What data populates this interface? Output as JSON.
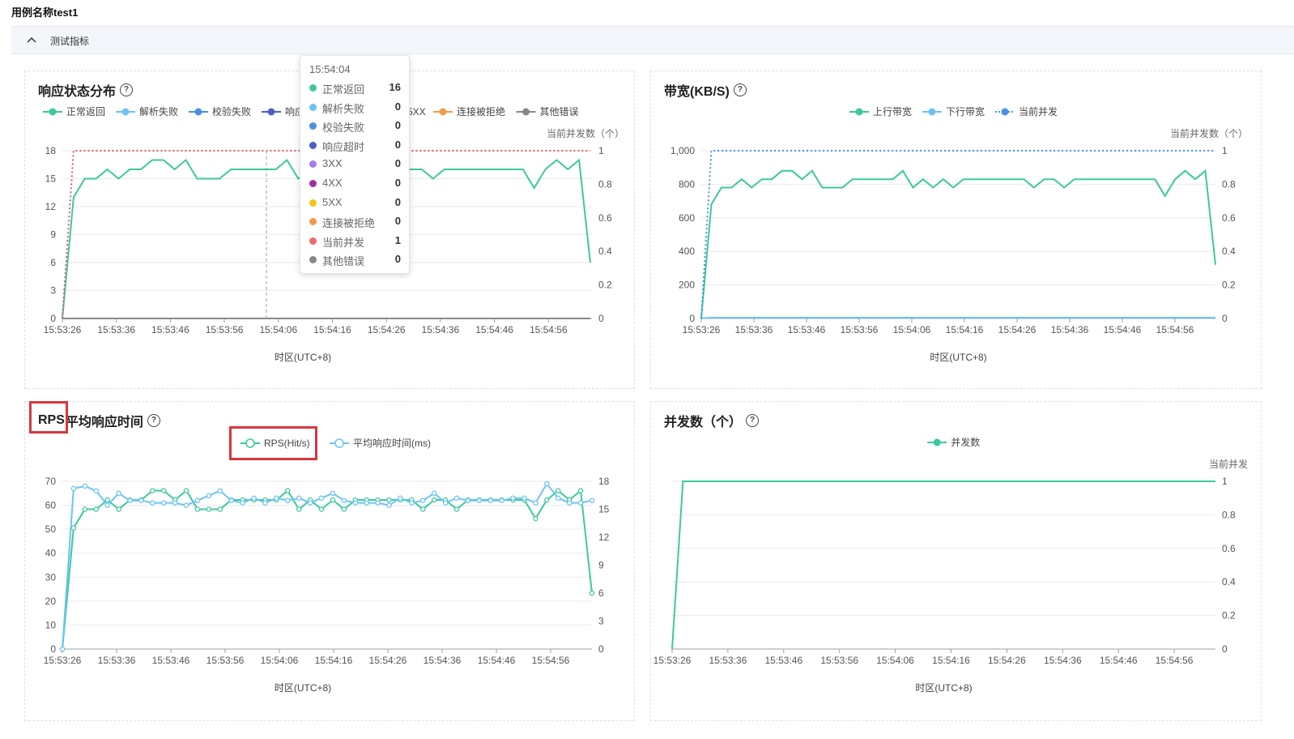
{
  "header": {
    "case_title": "用例名称test1",
    "section_label": "测试指标"
  },
  "panels": {
    "status": {
      "title": "响应状态分布"
    },
    "bandwidth": {
      "title": "带宽(KB/S)"
    },
    "rps": {
      "title_part1": "RPS",
      "title_part2": "平均响应时间"
    },
    "concurrency": {
      "title": "并发数（个）"
    }
  },
  "tooltip": {
    "time": "15:54:04",
    "rows": [
      {
        "name": "正常返回",
        "value": "16",
        "color": "#3cc99b"
      },
      {
        "name": "解析失败",
        "value": "0",
        "color": "#6ec3f4"
      },
      {
        "name": "校验失败",
        "value": "0",
        "color": "#4a90e2"
      },
      {
        "name": "响应超时",
        "value": "0",
        "color": "#4c5fc7"
      },
      {
        "name": "3XX",
        "value": "0",
        "color": "#a97be8"
      },
      {
        "name": "4XX",
        "value": "0",
        "color": "#9b2fa3"
      },
      {
        "name": "5XX",
        "value": "0",
        "color": "#f5c518"
      },
      {
        "name": "连接被拒绝",
        "value": "0",
        "color": "#f39a4a"
      },
      {
        "name": "当前并发",
        "value": "1",
        "color": "#ef6b6b"
      },
      {
        "name": "其他错误",
        "value": "0",
        "color": "#888888"
      }
    ]
  },
  "colors": {
    "green": "#3cc99b",
    "lightblue": "#6ec3f4",
    "blue": "#4a90e2",
    "red": "#e05a5a",
    "highlight": "#d9363e"
  },
  "chart_data": [
    {
      "type": "line",
      "id": "status",
      "legend": [
        {
          "name": "正常返回",
          "color": "#3cc99b"
        },
        {
          "name": "解析失败",
          "color": "#6ec3f4"
        },
        {
          "name": "校验失败",
          "color": "#4a90e2"
        },
        {
          "name": "响应超时",
          "color": "#4c5fc7"
        },
        {
          "name": "4XX",
          "color": "#9b2fa3"
        },
        {
          "name": "5XX",
          "color": "#f5c518"
        },
        {
          "name": "连接被拒绝",
          "color": "#f39a4a"
        },
        {
          "name": "其他错误",
          "color": "#888888"
        }
      ],
      "x_ticks": [
        "15:53:26",
        "15:53:36",
        "15:53:46",
        "15:53:56",
        "15:54:06",
        "15:54:16",
        "15:54:26",
        "15:54:36",
        "15:54:46",
        "15:54:56"
      ],
      "xlabel": "时区(UTC+8)",
      "y_left_ticks": [
        0,
        3,
        6,
        9,
        12,
        15,
        18
      ],
      "y_right_ticks": [
        0,
        0.2,
        0.4,
        0.6,
        0.8,
        1
      ],
      "y_right_label": "当前并发数（个）",
      "ylim_left": [
        0,
        18
      ],
      "ylim_right": [
        0,
        1
      ],
      "series": [
        {
          "name": "正常返回",
          "axis": "left",
          "color": "#3cc99b",
          "values": [
            0,
            13,
            15,
            15,
            16,
            15,
            16,
            16,
            17,
            17,
            16,
            17,
            15,
            15,
            15,
            16,
            16,
            16,
            16,
            16,
            17,
            15,
            16,
            16,
            16,
            15,
            16,
            16,
            16,
            16,
            16,
            16,
            16,
            15,
            16,
            16,
            16,
            16,
            16,
            16,
            16,
            16,
            14,
            16,
            17,
            16,
            17,
            6
          ]
        },
        {
          "name": "当前并发",
          "axis": "right",
          "color": "#e05a5a",
          "dashed": true,
          "values": [
            0,
            1,
            1,
            1,
            1,
            1,
            1,
            1,
            1,
            1,
            1,
            1,
            1,
            1,
            1,
            1,
            1,
            1,
            1,
            1,
            1,
            1,
            1,
            1,
            1,
            1,
            1,
            1,
            1,
            1,
            1,
            1,
            1,
            1,
            1,
            1,
            1,
            1,
            1,
            1,
            1,
            1,
            1,
            1,
            1,
            1,
            1,
            1
          ]
        },
        {
          "name": "其他错误",
          "axis": "left",
          "color": "#888888",
          "values": [
            0,
            0,
            0,
            0,
            0,
            0,
            0,
            0,
            0,
            0,
            0,
            0,
            0,
            0,
            0,
            0,
            0,
            0,
            0,
            0,
            0,
            0,
            0,
            0,
            0,
            0,
            0,
            0,
            0,
            0,
            0,
            0,
            0,
            0,
            0,
            0,
            0,
            0,
            0,
            0,
            0,
            0,
            0,
            0,
            0,
            0,
            0,
            0
          ]
        }
      ]
    },
    {
      "type": "line",
      "id": "bandwidth",
      "legend": [
        {
          "name": "上行带宽",
          "color": "#3cc99b"
        },
        {
          "name": "下行带宽",
          "color": "#6ec3f4"
        },
        {
          "name": "当前并发",
          "color": "#4a90e2",
          "dashed": true
        }
      ],
      "x_ticks": [
        "15:53:26",
        "15:53:36",
        "15:53:46",
        "15:53:56",
        "15:54:06",
        "15:54:16",
        "15:54:26",
        "15:54:36",
        "15:54:46",
        "15:54:56"
      ],
      "xlabel": "时区(UTC+8)",
      "y_left_ticks": [
        "0",
        "200",
        "400",
        "600",
        "800",
        "1,000"
      ],
      "y_right_ticks": [
        0,
        0.2,
        0.4,
        0.6,
        0.8,
        1
      ],
      "y_right_label": "当前并发数（个）",
      "ylim_left": [
        0,
        1000
      ],
      "ylim_right": [
        0,
        1
      ],
      "series": [
        {
          "name": "上行带宽",
          "axis": "left",
          "color": "#3cc99b",
          "values": [
            0,
            680,
            780,
            780,
            830,
            780,
            830,
            830,
            880,
            880,
            830,
            880,
            780,
            780,
            780,
            830,
            830,
            830,
            830,
            830,
            880,
            780,
            830,
            780,
            830,
            780,
            830,
            830,
            830,
            830,
            830,
            830,
            830,
            780,
            830,
            830,
            780,
            830,
            830,
            830,
            830,
            830,
            830,
            830,
            830,
            830,
            730,
            830,
            880,
            830,
            880,
            320
          ]
        },
        {
          "name": "下行带宽",
          "axis": "left",
          "color": "#6ec3f4",
          "values": [
            0,
            5,
            5,
            5,
            5,
            5,
            5,
            5,
            5,
            5,
            5,
            5,
            5,
            5,
            5,
            5,
            5,
            5,
            5,
            5,
            5,
            5,
            5,
            5,
            5,
            5,
            5,
            5,
            5,
            5,
            5,
            5,
            5,
            5,
            5,
            5,
            5,
            5,
            5,
            5,
            5,
            5,
            5,
            5,
            5,
            5,
            5,
            5,
            5,
            5,
            5,
            5
          ]
        },
        {
          "name": "当前并发",
          "axis": "right",
          "color": "#4a90e2",
          "dashed": true,
          "values": [
            0,
            1,
            1,
            1,
            1,
            1,
            1,
            1,
            1,
            1,
            1,
            1,
            1,
            1,
            1,
            1,
            1,
            1,
            1,
            1,
            1,
            1,
            1,
            1,
            1,
            1,
            1,
            1,
            1,
            1,
            1,
            1,
            1,
            1,
            1,
            1,
            1,
            1,
            1,
            1,
            1,
            1,
            1,
            1,
            1,
            1,
            1,
            1,
            1,
            1,
            1,
            1
          ]
        }
      ]
    },
    {
      "type": "line",
      "id": "rps",
      "legend": [
        {
          "name": "RPS(Hit/s)",
          "color": "#3cc99b"
        },
        {
          "name": "平均响应时间(ms)",
          "color": "#6ec3f4"
        }
      ],
      "x_ticks": [
        "15:53:26",
        "15:53:36",
        "15:53:46",
        "15:53:56",
        "15:54:06",
        "15:54:16",
        "15:54:26",
        "15:54:36",
        "15:54:46",
        "15:54:56"
      ],
      "xlabel": "时区(UTC+8)",
      "y_left_ticks": [
        0,
        10,
        20,
        30,
        40,
        50,
        60,
        70
      ],
      "y_right_ticks": [
        0,
        3,
        6,
        9,
        12,
        15,
        18
      ],
      "ylim_left": [
        0,
        70
      ],
      "ylim_right": [
        0,
        18
      ],
      "series": [
        {
          "name": "RPS(Hit/s)",
          "axis": "right",
          "color": "#3cc99b",
          "values": [
            0,
            13,
            15,
            15,
            16,
            15,
            16,
            16,
            17,
            17,
            16,
            17,
            15,
            15,
            15,
            16,
            16,
            16,
            16,
            16,
            17,
            15,
            16,
            15,
            16,
            15,
            16,
            16,
            16,
            16,
            16,
            16,
            15,
            16,
            16,
            15,
            16,
            16,
            16,
            16,
            16,
            16,
            14,
            16,
            17,
            16,
            17,
            6
          ]
        },
        {
          "name": "平均响应时间(ms)",
          "axis": "left",
          "color": "#6ec3f4",
          "values": [
            0,
            67,
            68,
            66,
            60,
            65,
            62,
            62,
            61,
            61,
            61,
            60,
            62,
            64,
            66,
            62,
            61,
            63,
            61,
            63,
            62,
            63,
            61,
            63,
            65,
            62,
            61,
            61,
            61,
            60,
            63,
            61,
            62,
            65,
            61,
            63,
            62,
            62,
            62,
            62,
            63,
            63,
            61,
            69,
            63,
            61,
            61,
            62
          ]
        }
      ]
    },
    {
      "type": "line",
      "id": "concurrency",
      "legend": [
        {
          "name": "并发数",
          "color": "#3cc99b"
        }
      ],
      "x_ticks": [
        "15:53:26",
        "15:53:36",
        "15:53:46",
        "15:53:56",
        "15:54:06",
        "15:54:16",
        "15:54:26",
        "15:54:36",
        "15:54:46",
        "15:54:56"
      ],
      "xlabel": "时区(UTC+8)",
      "y_right_ticks": [
        0,
        0.2,
        0.4,
        0.6,
        0.8,
        1
      ],
      "y_right_label": "当前并发",
      "ylim_right": [
        0,
        1
      ],
      "series": [
        {
          "name": "并发数",
          "axis": "right",
          "color": "#3cc99b",
          "values": [
            0,
            1,
            1,
            1,
            1,
            1,
            1,
            1,
            1,
            1,
            1,
            1,
            1,
            1,
            1,
            1,
            1,
            1,
            1,
            1,
            1,
            1,
            1,
            1,
            1,
            1,
            1,
            1,
            1,
            1,
            1,
            1,
            1,
            1,
            1,
            1,
            1,
            1,
            1,
            1,
            1,
            1,
            1,
            1,
            1,
            1,
            1,
            1,
            1,
            1,
            1
          ]
        }
      ]
    }
  ]
}
